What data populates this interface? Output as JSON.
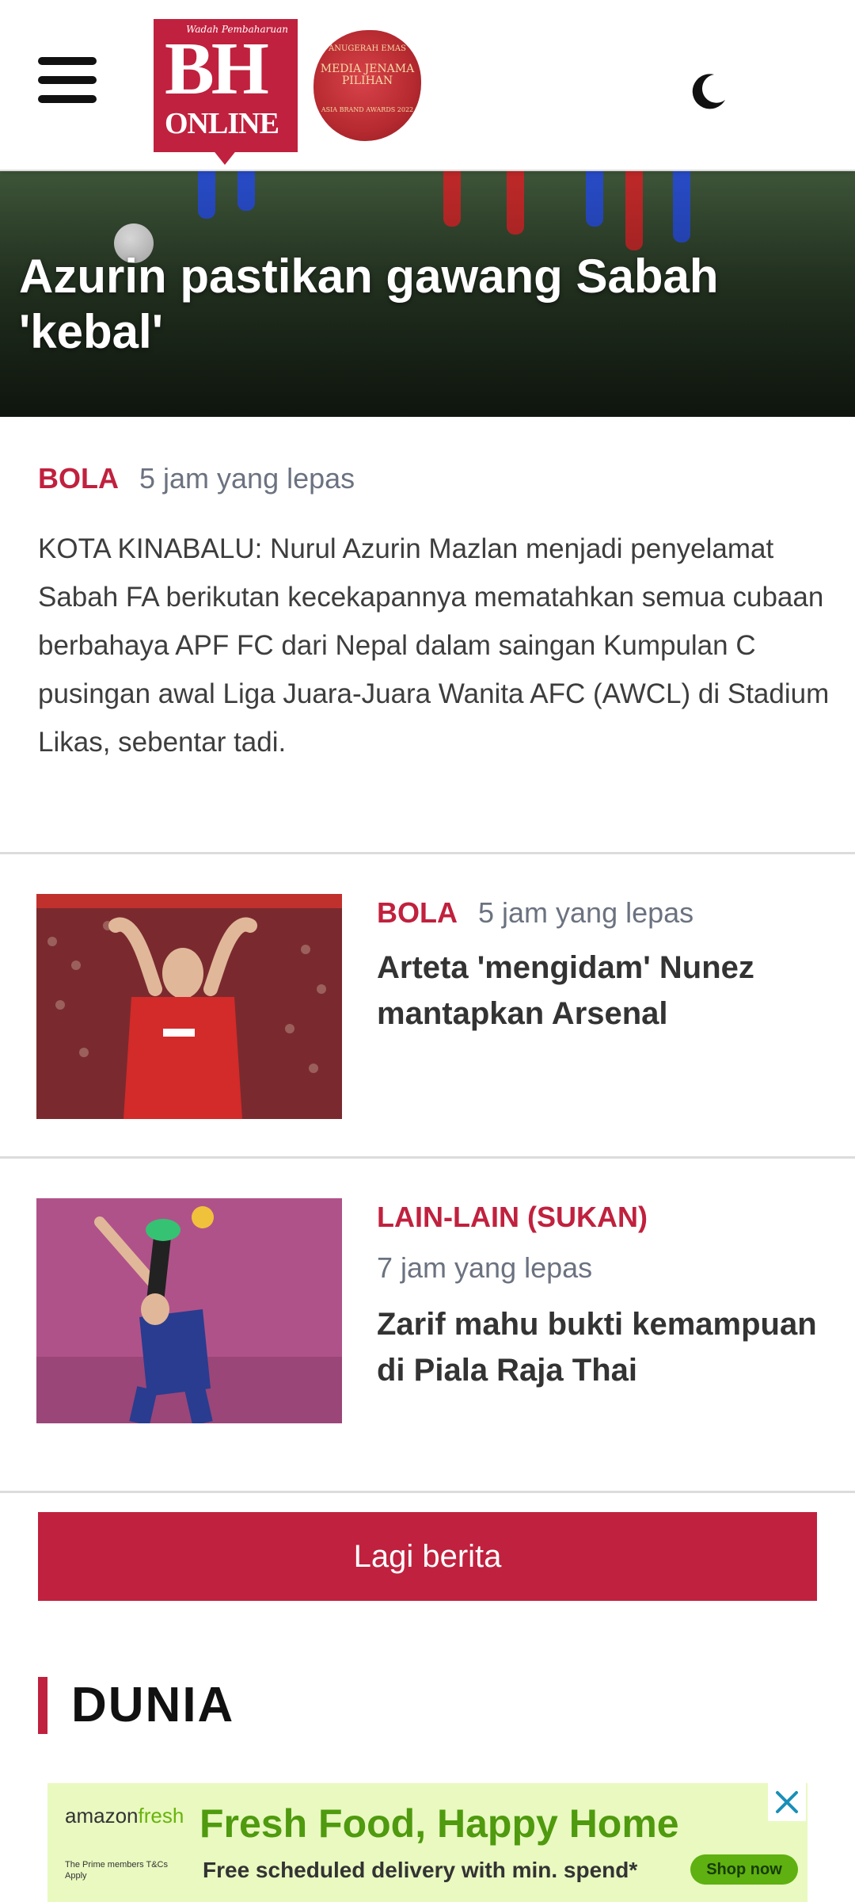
{
  "header": {
    "logo_tagline": "Wadah Pembaharuan",
    "logo_main": "BH",
    "logo_sub": "ONLINE",
    "award_top": "ANUGERAH EMAS",
    "award_main": "MEDIA JENAMA PILIHAN",
    "award_bottom": "ASIA BRAND AWARDS 2022",
    "menu_icon": "hamburger-menu-icon",
    "theme_icon": "moon-icon"
  },
  "hero": {
    "title": "Azurin pastikan gawang Sabah 'kebal'"
  },
  "lead": {
    "category": "BOLA",
    "time": "5 jam yang lepas",
    "summary": "KOTA KINABALU: Nurul Azurin Mazlan menjadi penyelamat Sabah FA berikutan kecekapannya mematahkan semua cubaan berbahaya APF FC dari Nepal dalam saingan Kumpulan C pusingan awal Liga Juara-Juara Wanita AFC (AWCL) di Stadium Likas, sebentar tadi."
  },
  "stories": [
    {
      "category": "BOLA",
      "time": "5 jam yang lepas",
      "headline": "Arteta 'mengidam' Nunez mantapkan Arsenal"
    },
    {
      "category": "LAIN-LAIN (SUKAN)",
      "time": "7 jam yang lepas",
      "headline": "Zarif mahu bukti kemampuan di Piala Raja Thai"
    }
  ],
  "more_button": "Lagi berita",
  "section": {
    "title": "DUNIA"
  },
  "ad": {
    "brand_part1": "amazon",
    "brand_part2": "fresh",
    "headline": "Fresh Food, Happy Home",
    "fine_print": "The Prime members T&Cs Apply",
    "subline": "Free scheduled delivery with min. spend*",
    "cta": "Shop now",
    "close_icon": "close-icon"
  },
  "colors": {
    "brand_red": "#c0213e",
    "meta_gray": "#6b7280",
    "ad_green": "#4f9a0e"
  }
}
